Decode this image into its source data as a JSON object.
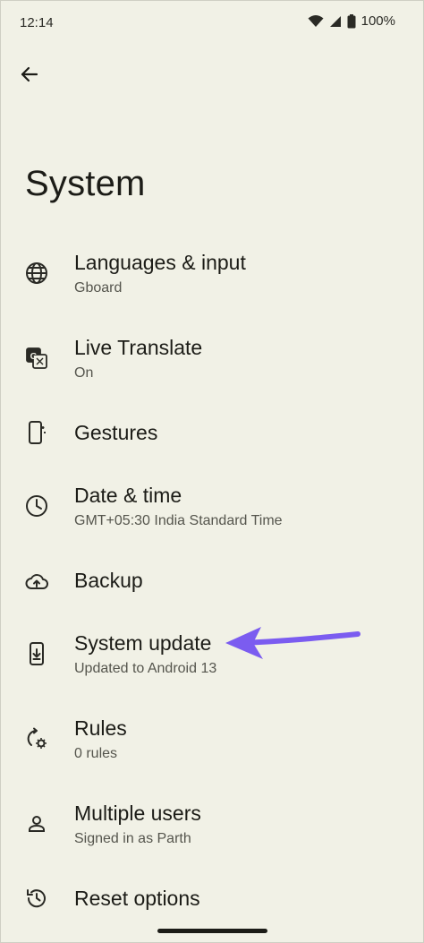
{
  "status_bar": {
    "time": "12:14",
    "battery": "100%",
    "icons": [
      "wifi-icon",
      "signal-icon",
      "battery-icon"
    ]
  },
  "header": {
    "back_icon": "arrow-back-icon",
    "title": "System"
  },
  "items": [
    {
      "icon": "globe-icon",
      "title": "Languages & input",
      "subtitle": "Gboard"
    },
    {
      "icon": "translate-icon",
      "title": "Live Translate",
      "subtitle": "On"
    },
    {
      "icon": "gestures-phone-icon",
      "title": "Gestures",
      "subtitle": ""
    },
    {
      "icon": "clock-icon",
      "title": "Date & time",
      "subtitle": "GMT+05:30 India Standard Time"
    },
    {
      "icon": "cloud-upload-icon",
      "title": "Backup",
      "subtitle": ""
    },
    {
      "icon": "system-update-icon",
      "title": "System update",
      "subtitle": "Updated to Android 13"
    },
    {
      "icon": "rules-icon",
      "title": "Rules",
      "subtitle": "0 rules"
    },
    {
      "icon": "person-icon",
      "title": "Multiple users",
      "subtitle": "Signed in as Parth"
    },
    {
      "icon": "history-icon",
      "title": "Reset options",
      "subtitle": ""
    }
  ],
  "annotation": {
    "arrow_color": "#7b5cf0",
    "points_to": "System update"
  }
}
